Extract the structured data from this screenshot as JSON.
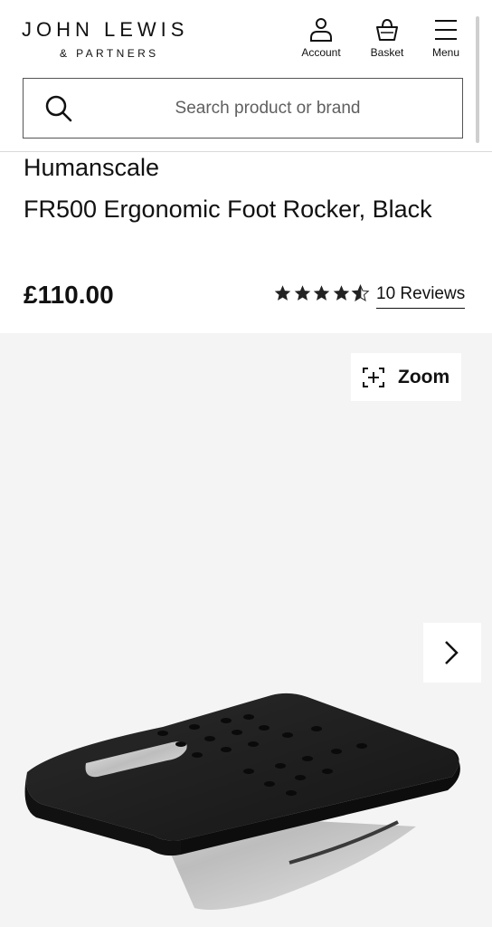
{
  "header": {
    "logo_line1": "JOHN LEWIS",
    "logo_line2": "& PARTNERS",
    "account_label": "Account",
    "basket_label": "Basket",
    "menu_label": "Menu"
  },
  "search": {
    "placeholder": "Search product or brand"
  },
  "product": {
    "brand": "Humanscale",
    "title": "FR500 Ergonomic Foot Rocker, Black",
    "price": "£110.00",
    "rating": 4.5,
    "reviews_link": "10 Reviews"
  },
  "gallery": {
    "zoom_label": "Zoom"
  },
  "icons": {
    "account": "account-icon",
    "basket": "basket-icon",
    "menu": "menu-icon",
    "search": "search-icon",
    "zoom": "zoom-icon",
    "next": "chevron-right-icon"
  },
  "colors": {
    "text": "#111111",
    "gallery_background": "#f4f4f4",
    "product_black": "#1e1e1e",
    "product_steel": "#c9c9c9"
  }
}
